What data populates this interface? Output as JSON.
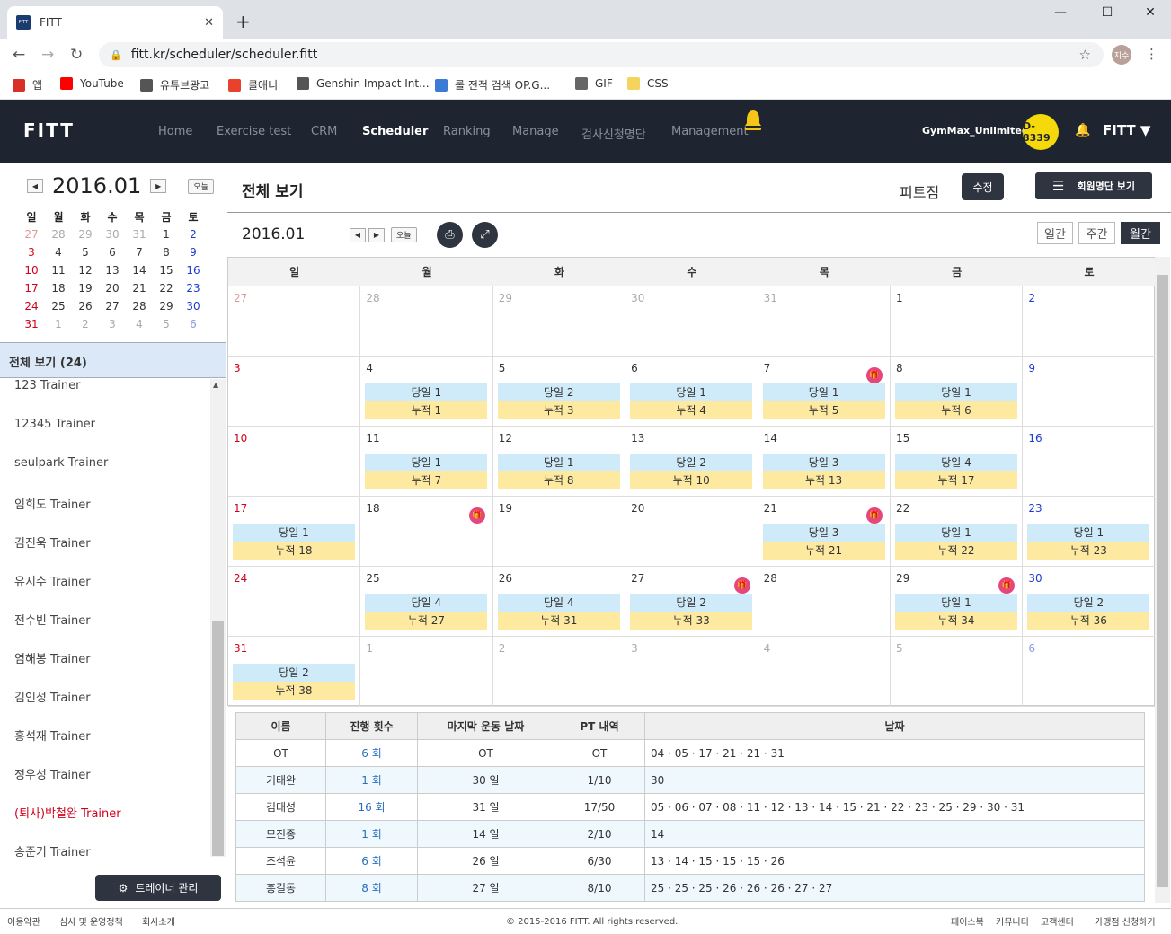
{
  "browser": {
    "tab_title": "FITT",
    "url": "fitt.kr/scheduler/scheduler.fitt",
    "profile_initials": "지수",
    "bookmarks": [
      "앱",
      "YouTube",
      "유튜브광고",
      "클애니",
      "Genshin Impact Int...",
      "롤 전적 검색 OP.G...",
      "GIF",
      "CSS"
    ]
  },
  "header": {
    "logo": "FITT",
    "menu": [
      "Home",
      "Exercise test",
      "CRM",
      "Scheduler",
      "Ranking",
      "Manage",
      "검사신청명단",
      "Management"
    ],
    "active_menu": "Scheduler",
    "gym_name": "GymMax_Unlimited",
    "d_day": "D-8339",
    "user_menu": "FITT"
  },
  "sidebar": {
    "mini_title": "2016.01",
    "today_label": "오늘",
    "weekdays": [
      "일",
      "월",
      "화",
      "수",
      "목",
      "금",
      "토"
    ],
    "mini_weeks": [
      [
        "27",
        "28",
        "29",
        "30",
        "31",
        "1",
        "2"
      ],
      [
        "3",
        "4",
        "5",
        "6",
        "7",
        "8",
        "9"
      ],
      [
        "10",
        "11",
        "12",
        "13",
        "14",
        "15",
        "16"
      ],
      [
        "17",
        "18",
        "19",
        "20",
        "21",
        "22",
        "23"
      ],
      [
        "24",
        "25",
        "26",
        "27",
        "28",
        "29",
        "30"
      ],
      [
        "31",
        "1",
        "2",
        "3",
        "4",
        "5",
        "6"
      ]
    ],
    "all_view": "전체 보기 (24)",
    "trainers": [
      "123 Trainer",
      "12345 Trainer",
      "seulpark Trainer",
      "임희도 Trainer",
      "김진욱 Trainer",
      "유지수 Trainer",
      "전수빈 Trainer",
      "염해봉 Trainer",
      "김인성 Trainer",
      "홍석재 Trainer",
      "정우성 Trainer",
      "(퇴사)박철완 Trainer",
      "송준기 Trainer"
    ],
    "trainer_manage_btn": "트레이너 관리"
  },
  "main": {
    "page_title": "전체 보기",
    "gym_label": "피트짐",
    "edit_btn": "수정",
    "roster_btn": "회원명단 보기",
    "cal_date": "2016.01",
    "today_label": "오늘",
    "views": [
      "일간",
      "주간",
      "월간"
    ],
    "active_view": "월간"
  },
  "calendar": {
    "weekdays": [
      "일",
      "월",
      "화",
      "수",
      "목",
      "금",
      "토"
    ],
    "weeks": [
      [
        {
          "d": "27",
          "o": 1
        },
        {
          "d": "28",
          "o": 1
        },
        {
          "d": "29",
          "o": 1
        },
        {
          "d": "30",
          "o": 1
        },
        {
          "d": "31",
          "o": 1
        },
        {
          "d": "1"
        },
        {
          "d": "2"
        }
      ],
      [
        {
          "d": "3"
        },
        {
          "d": "4",
          "a": "당일 1",
          "b": "누적 1"
        },
        {
          "d": "5",
          "a": "당일 2",
          "b": "누적 3"
        },
        {
          "d": "6",
          "a": "당일 1",
          "b": "누적 4"
        },
        {
          "d": "7",
          "a": "당일 1",
          "b": "누적 5",
          "g": 1
        },
        {
          "d": "8",
          "a": "당일 1",
          "b": "누적 6"
        },
        {
          "d": "9"
        }
      ],
      [
        {
          "d": "10"
        },
        {
          "d": "11",
          "a": "당일 1",
          "b": "누적 7"
        },
        {
          "d": "12",
          "a": "당일 1",
          "b": "누적 8"
        },
        {
          "d": "13",
          "a": "당일 2",
          "b": "누적 10"
        },
        {
          "d": "14",
          "a": "당일 3",
          "b": "누적 13"
        },
        {
          "d": "15",
          "a": "당일 4",
          "b": "누적 17"
        },
        {
          "d": "16"
        }
      ],
      [
        {
          "d": "17",
          "a": "당일 1",
          "b": "누적 18"
        },
        {
          "d": "18",
          "g": 1
        },
        {
          "d": "19"
        },
        {
          "d": "20"
        },
        {
          "d": "21",
          "a": "당일 3",
          "b": "누적 21",
          "g": 1
        },
        {
          "d": "22",
          "a": "당일 1",
          "b": "누적 22"
        },
        {
          "d": "23",
          "a": "당일 1",
          "b": "누적 23"
        }
      ],
      [
        {
          "d": "24"
        },
        {
          "d": "25",
          "a": "당일 4",
          "b": "누적 27"
        },
        {
          "d": "26",
          "a": "당일 4",
          "b": "누적 31"
        },
        {
          "d": "27",
          "a": "당일 2",
          "b": "누적 33",
          "g": 1
        },
        {
          "d": "28"
        },
        {
          "d": "29",
          "a": "당일 1",
          "b": "누적 34",
          "g": 1
        },
        {
          "d": "30",
          "a": "당일 2",
          "b": "누적 36"
        }
      ],
      [
        {
          "d": "31",
          "a": "당일 2",
          "b": "누적 38"
        },
        {
          "d": "1",
          "o": 1
        },
        {
          "d": "2",
          "o": 1
        },
        {
          "d": "3",
          "o": 1
        },
        {
          "d": "4",
          "o": 1
        },
        {
          "d": "5",
          "o": 1
        },
        {
          "d": "6",
          "o": 1
        }
      ]
    ]
  },
  "summary": {
    "headers": [
      "이름",
      "진행 횟수",
      "마지막 운동 날짜",
      "PT 내역",
      "날짜"
    ],
    "rows": [
      [
        "OT",
        "6 회",
        "OT",
        "OT",
        "04 · 05 · 17 · 21 · 21 · 31"
      ],
      [
        "기태완",
        "1 회",
        "30 일",
        "1/10",
        "30"
      ],
      [
        "김태성",
        "16 회",
        "31 일",
        "17/50",
        "05 · 06 · 07 · 08 · 11 · 12 · 13 · 14 · 15 · 21 · 22 · 23 · 25 · 29 · 30 · 31"
      ],
      [
        "모진종",
        "1 회",
        "14 일",
        "2/10",
        "14"
      ],
      [
        "조석윤",
        "6 회",
        "26 일",
        "6/30",
        "13 · 14 · 15 · 15 · 15 · 26"
      ],
      [
        "홍길동",
        "8 회",
        "27 일",
        "8/10",
        "25 · 25 · 25 · 26 · 26 · 26 · 27 · 27"
      ]
    ]
  },
  "footer": {
    "left_links": [
      "이용약관",
      "심사 및 운영정책",
      "회사소개"
    ],
    "copyright": "© 2015-2016 FITT. All rights reserved.",
    "right_links": [
      "페이스북",
      "커뮤니티",
      "고객센터",
      "가맹점 신청하기"
    ]
  },
  "colors": {
    "header_bg": "#1e2430",
    "event_day": "#cfeaf8",
    "event_total": "#fde9a0",
    "gift_badge": "#e5467c",
    "dday_badge": "#f5d90a"
  }
}
